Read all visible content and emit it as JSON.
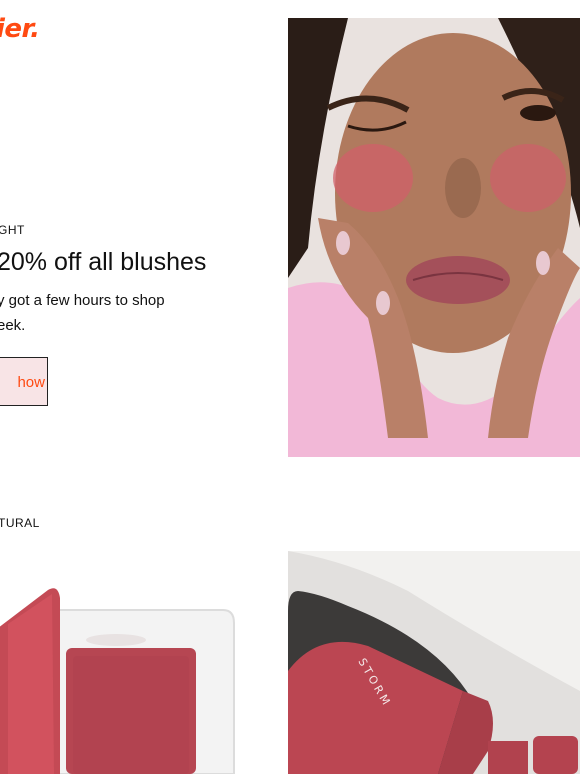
{
  "brand": {
    "logo_text": "ier."
  },
  "promo": {
    "eyebrow": "GHT",
    "headline": "20% off all blushes",
    "body": "y got a few hours to shop eek.",
    "button_label": "how"
  },
  "section2": {
    "eyebrow": "TURAL"
  },
  "product_label": "STORM",
  "colors": {
    "accent": "#ff4a12",
    "button_bg": "#f8e4e6",
    "blush": "#c44a52"
  }
}
